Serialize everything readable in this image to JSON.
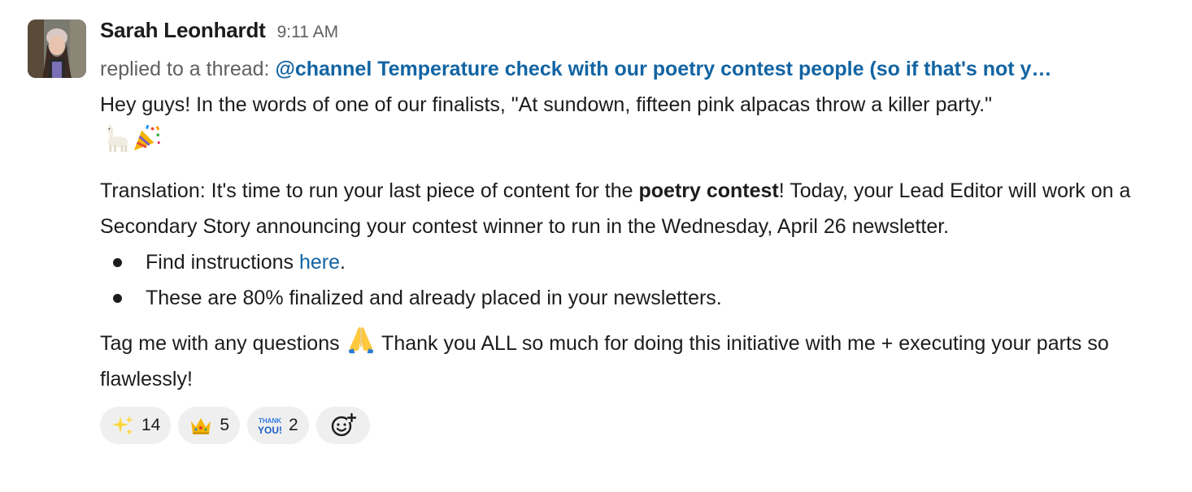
{
  "message": {
    "author": "Sarah Leonhardt",
    "time": "9:11 AM",
    "thread_prefix": "replied to a thread:",
    "thread_link": "@channel Temperature check with our poetry contest people (so if that's not y…",
    "p1": "Hey guys! In the words of one of our finalists, \"At sundown, fifteen pink alpacas throw a killer party.\"",
    "p1_emojis": [
      "llama-emoji",
      "party-popper-emoji"
    ],
    "p2_before": "Translation: It's time to run your last piece of content for the ",
    "p2_bold": "poetry contest",
    "p2_after": "! Today, your Lead Editor will work on a Secondary Story announcing your contest winner to run in the Wednesday, April 26 newsletter.",
    "bullet1_before": "Find instructions ",
    "bullet1_link": "here",
    "bullet1_after": ".",
    "bullet2": "These are 80% finalized and already placed in your newsletters.",
    "p3_before": "Tag me with any questions ",
    "p3_emoji": "folded-hands-emoji",
    "p3_after": " Thank you ALL so much for doing this initiative with me + executing your parts so flawlessly!"
  },
  "reactions": [
    {
      "icon": "sparkles-emoji",
      "count": "14"
    },
    {
      "icon": "crown-emoji",
      "count": "5"
    },
    {
      "icon": "thank-you-emoji",
      "count": "2"
    }
  ],
  "add_reaction_icon": "add-reaction-icon",
  "colors": {
    "link": "#1264a3",
    "muted": "#616061",
    "text": "#1d1c1d",
    "pill": "#efefef"
  }
}
